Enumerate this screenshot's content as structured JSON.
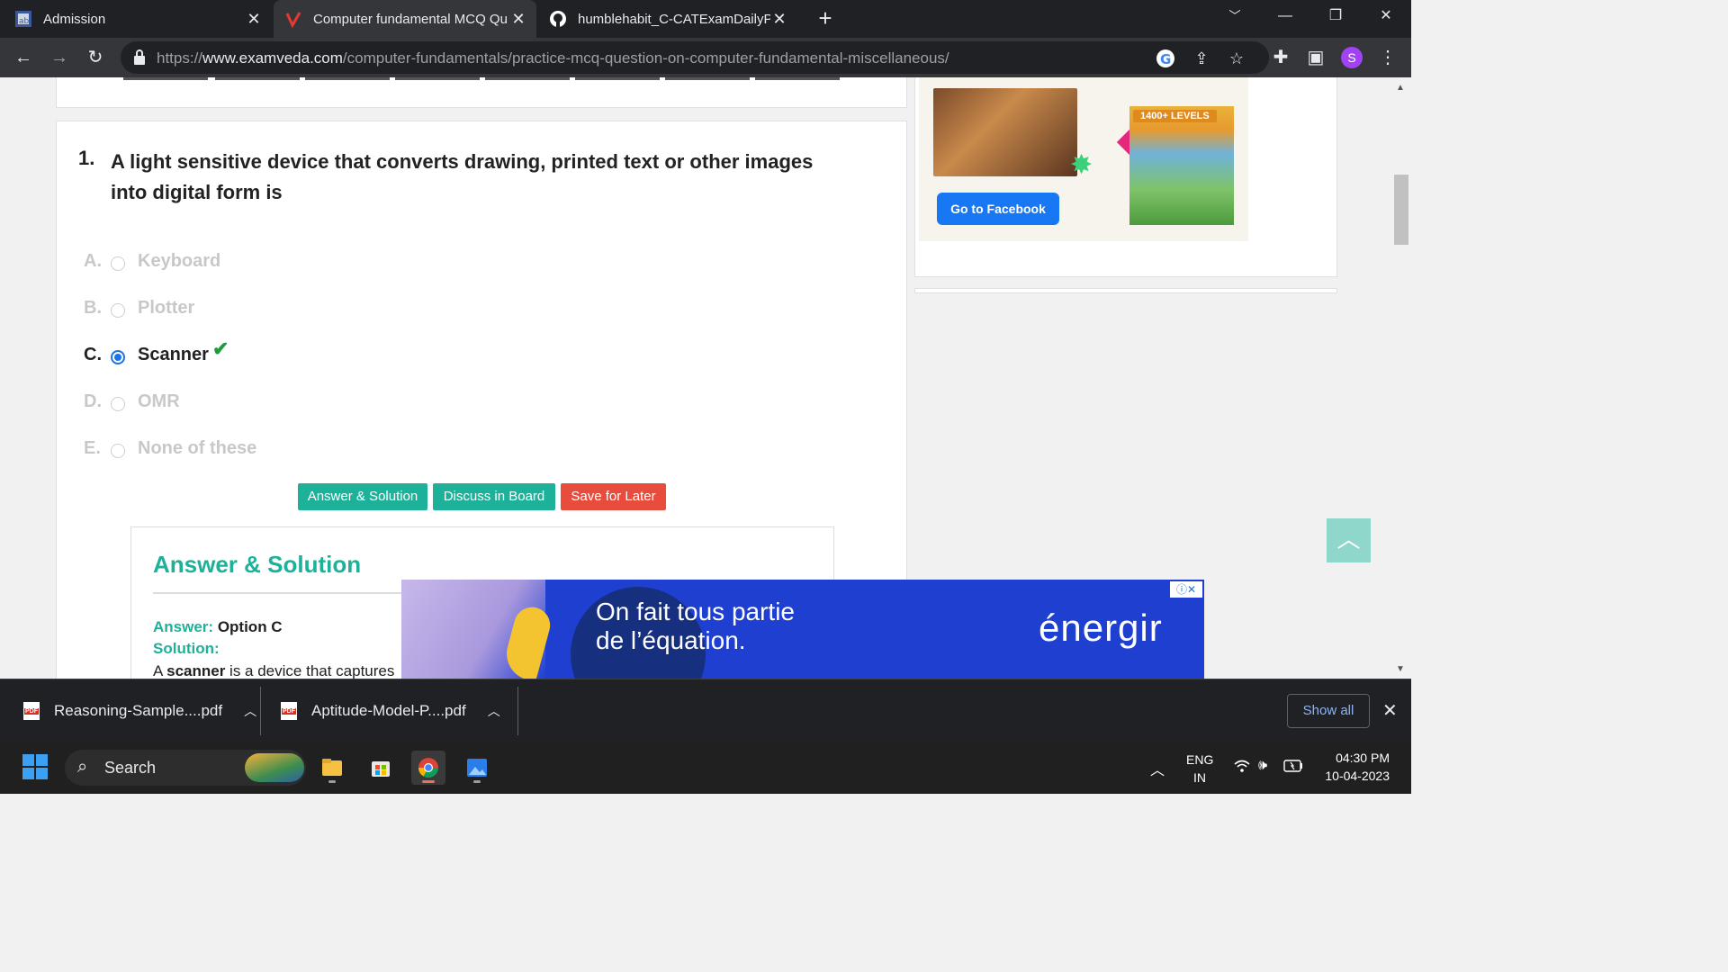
{
  "browser": {
    "tabs": [
      {
        "title": "Admission",
        "icon": "college-favicon"
      },
      {
        "title": "Computer fundamental MCQ Qu",
        "icon": "examveda-favicon"
      },
      {
        "title": "humblehabit_C-CATExamDailyPra",
        "icon": "github-favicon"
      }
    ],
    "new_tab": "+",
    "url_prefix": "https://",
    "url_domain": "www.examveda.com",
    "url_path": "/computer-fundamentals/practice-mcq-question-on-computer-fundamental-miscellaneous/",
    "profile_initial": "S"
  },
  "question": {
    "number": "1.",
    "text": "A light sensitive device that converts drawing, printed text or other images into digital form is",
    "options": [
      {
        "letter": "A.",
        "text": "Keyboard"
      },
      {
        "letter": "B.",
        "text": "Plotter"
      },
      {
        "letter": "C.",
        "text": "Scanner",
        "selected": true,
        "correct": true
      },
      {
        "letter": "D.",
        "text": "OMR"
      },
      {
        "letter": "E.",
        "text": "None of these"
      }
    ],
    "correct_mark": "✔"
  },
  "actions": {
    "answer": "Answer & Solution",
    "discuss": "Discuss in Board",
    "save": "Save for Later",
    "colors": {
      "answer": "#1eb19a",
      "discuss": "#1eb19a",
      "save": "#e74c3c"
    }
  },
  "solution": {
    "heading": "Answer & Solution",
    "answer_label": "Answer:",
    "answer_value": "Option C",
    "solution_label": "Solution:",
    "text_pre": "A ",
    "text_bold": "scanner",
    "text_post": " is a device that captures"
  },
  "sidebar_ad": {
    "button": "Go to Facebook",
    "badge": "1400+ LEVELS"
  },
  "banner_ad": {
    "line1": "On fait tous partie",
    "line2": "de l’équation.",
    "brand": "énergir",
    "controls": "ⓘ✕"
  },
  "downloads": {
    "items": [
      "Reasoning-Sample....pdf",
      "Aptitude-Model-P....pdf"
    ],
    "show_all": "Show all"
  },
  "taskbar": {
    "search_label": "Search",
    "lang_line1": "ENG",
    "lang_line2": "IN",
    "time": "04:30 PM",
    "date": "10-04-2023"
  }
}
